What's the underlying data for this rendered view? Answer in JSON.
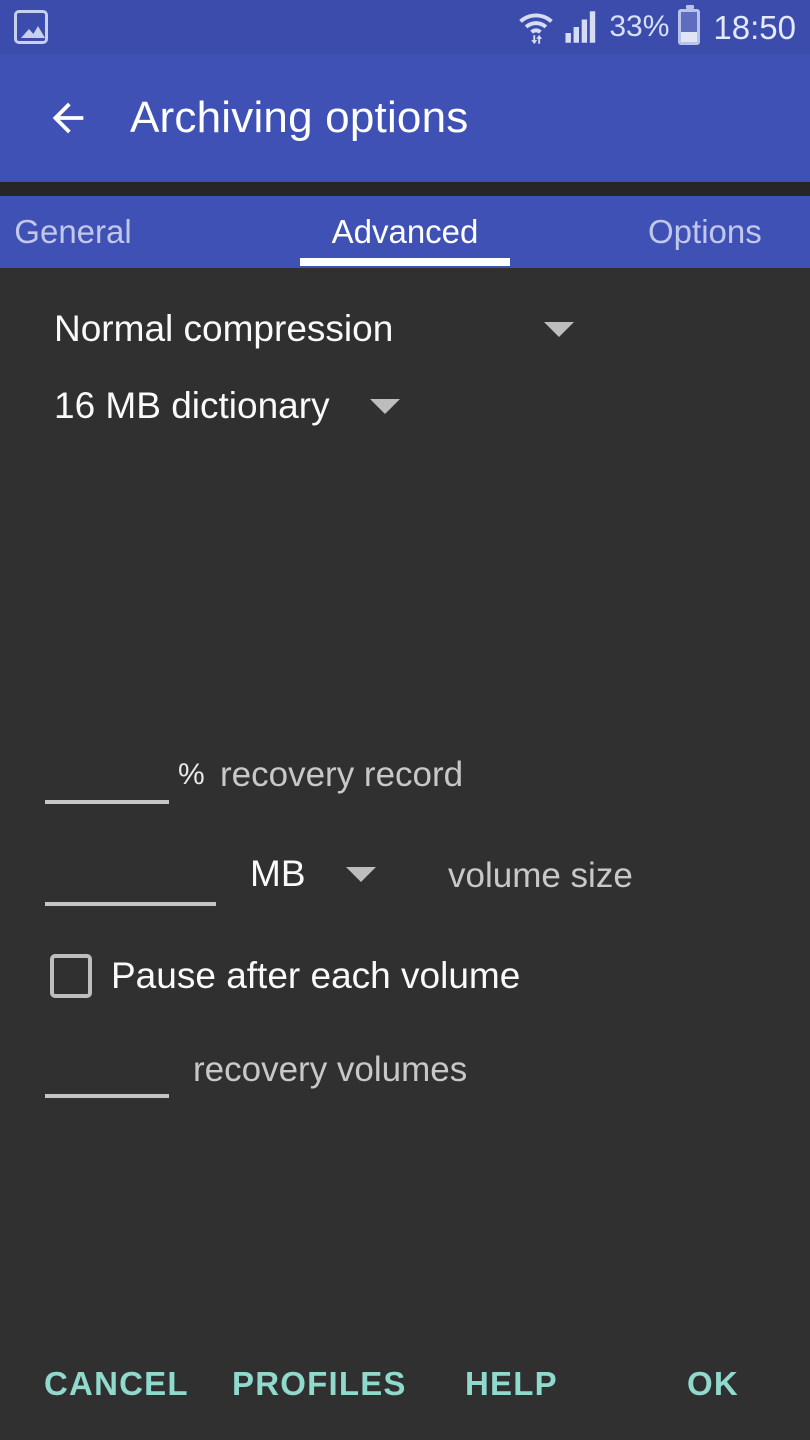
{
  "status_bar": {
    "notification_icon": "photo-icon",
    "wifi_icon": "wifi-icon",
    "signal_icon": "cellular-signal-icon",
    "battery_percent": "33%",
    "battery_level": 33,
    "time": "18:50"
  },
  "app_bar": {
    "back_icon": "arrow-back-icon",
    "title": "Archiving options"
  },
  "tabs": {
    "items": [
      {
        "label": "General",
        "active": false
      },
      {
        "label": "Advanced",
        "active": true
      },
      {
        "label": "Options",
        "active": false
      }
    ]
  },
  "content": {
    "compression": {
      "value": "Normal compression",
      "caret_icon": "chevron-down-icon"
    },
    "dictionary": {
      "value": "16 MB dictionary",
      "caret_icon": "chevron-down-icon"
    },
    "recovery_record": {
      "value": "",
      "placeholder": "",
      "unit": "%",
      "caption": "recovery record"
    },
    "volume_size": {
      "value": "",
      "placeholder": "",
      "unit": "MB",
      "unit_caret_icon": "chevron-down-icon",
      "caption": "volume size"
    },
    "pause_checkbox": {
      "label": "Pause after each volume",
      "checked": false
    },
    "recovery_volumes": {
      "value": "",
      "placeholder": "",
      "caption": "recovery volumes"
    }
  },
  "buttons": {
    "cancel": "CANCEL",
    "profiles": "PROFILES",
    "help": "HELP",
    "ok": "OK"
  },
  "colors": {
    "status_bar": "#3b4cad",
    "app_bar": "#3f51b5",
    "background": "#303030",
    "accent": "#8fd9cd",
    "tab_active_text": "#ffffff",
    "tab_inactive_text": "#c2c8ea"
  }
}
